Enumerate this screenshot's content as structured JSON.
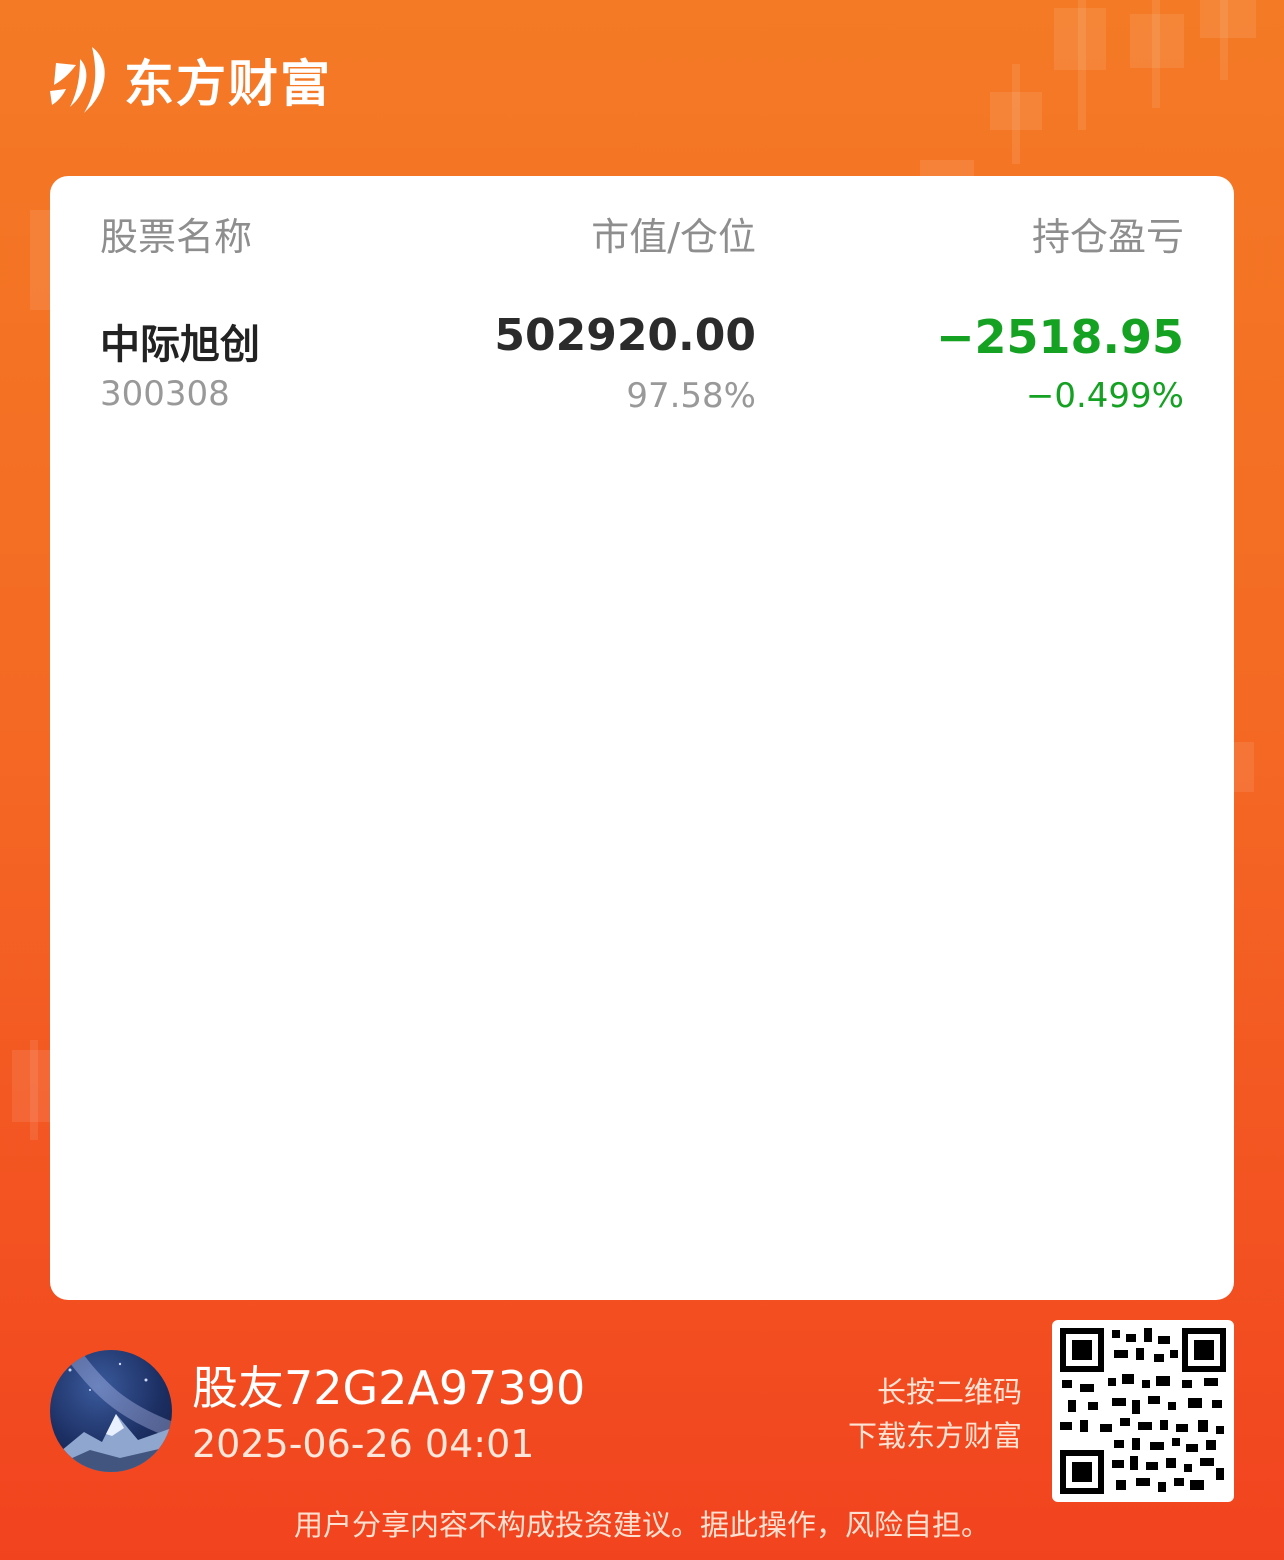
{
  "brand": {
    "name": "东方财富"
  },
  "table": {
    "headers": {
      "name": "股票名称",
      "value": "市值/仓位",
      "pl": "持仓盈亏"
    },
    "rows": [
      {
        "name": "中际旭创",
        "code": "300308",
        "market_value": "502920.00",
        "position_pct": "97.58%",
        "pl_amount": "−2518.95",
        "pl_pct": "−0.499%"
      }
    ]
  },
  "footer": {
    "username": "股友72G2A97390",
    "timestamp": "2025-06-26 04:01",
    "qr_hint_line1": "长按二维码",
    "qr_hint_line2": "下载东方财富",
    "disclaimer": "用户分享内容不构成投资建议。据此操作，风险自担。"
  },
  "colors": {
    "accent": "#f46a24",
    "loss": "#15a122"
  },
  "icons": {
    "logo": "eastmoney-logo-icon",
    "avatar": "mountain-night-avatar",
    "qr": "qr-code"
  }
}
